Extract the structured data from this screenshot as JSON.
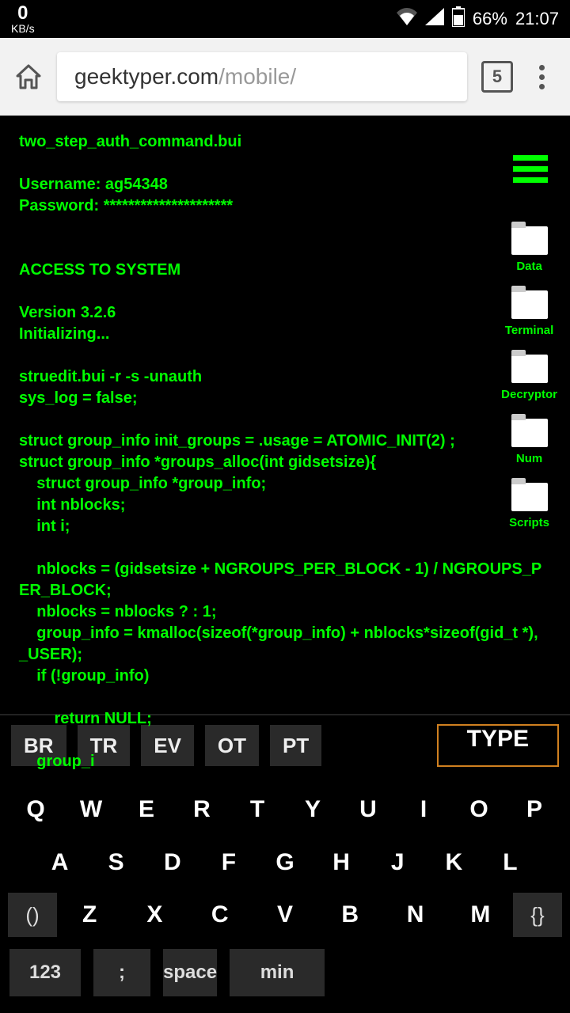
{
  "status": {
    "speed_value": "0",
    "speed_unit": "KB/s",
    "battery": "66%",
    "time": "21:07"
  },
  "browser": {
    "url_domain": "geektyper.com",
    "url_path": "/mobile/",
    "tab_count": "5"
  },
  "terminal": {
    "lines": "two_step_auth_command.bui\n\nUsername: ag54348\nPassword: *********************\n\n\nACCESS TO SYSTEM\n\nVersion 3.2.6\nInitializing...\n\nstruedit.bui -r -s -unauth\nsys_log = false;\n\nstruct group_info init_groups = .usage = ATOMIC_INIT(2) ;\nstruct group_info *groups_alloc(int gidsetsize){\n    struct group_info *group_info;\n    int nblocks;\n    int i;\n\n    nblocks = (gidsetsize + NGROUPS_PER_BLOCK - 1) / NGROUPS_PER_BLOCK;\n    nblocks = nblocks ? : 1;\n    group_info = kmalloc(sizeof(*group_info) + nblocks*sizeof(gid_t *), _USER);\n    if (!group_info)\n\n        return NULL;\n\n    group_i"
  },
  "folders": [
    {
      "label": "Data"
    },
    {
      "label": "Terminal"
    },
    {
      "label": "Decryptor"
    },
    {
      "label": "Num"
    },
    {
      "label": "Scripts"
    }
  ],
  "keyboard": {
    "suggestions": [
      "BR",
      "TR",
      "EV",
      "OT",
      "PT"
    ],
    "type_button": "TYPE",
    "row1": [
      "Q",
      "W",
      "E",
      "R",
      "T",
      "Y",
      "U",
      "I",
      "O",
      "P"
    ],
    "row2": [
      "A",
      "S",
      "D",
      "F",
      "G",
      "H",
      "J",
      "K",
      "L"
    ],
    "row3_left": "()",
    "row3": [
      "Z",
      "X",
      "C",
      "V",
      "B",
      "N",
      "M"
    ],
    "row3_right": "{}",
    "bottom": {
      "numbers": "123",
      "semi": ";",
      "space": "space",
      "min": "min"
    }
  }
}
